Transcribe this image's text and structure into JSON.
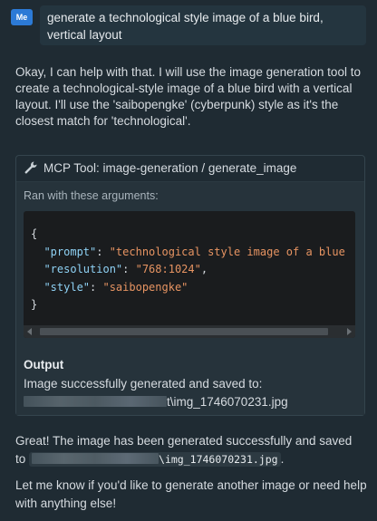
{
  "user_message": {
    "avatar": "Me",
    "text": "generate a technological style image of a blue bird, vertical layout"
  },
  "assistant_reply": "Okay, I can help with that. I will use the image generation tool to create a technological-style image of a blue bird with a vertical layout. I'll use the 'saibopengke' (cyberpunk) style as it's the closest match for 'technological'.",
  "tool_call": {
    "header": "MCP Tool: image-generation / generate_image",
    "icon": "wrench-icon",
    "arguments_label": "Ran with these arguments:",
    "code": {
      "open_brace": "{",
      "close_brace": "}",
      "args": [
        {
          "key": "\"prompt\"",
          "value": "\"technological style image of a blue",
          "comma": ""
        },
        {
          "key": "\"resolution\"",
          "value": "\"768:1024\"",
          "comma": ","
        },
        {
          "key": "\"style\"",
          "value": "\"saibopengke\"",
          "comma": ""
        }
      ]
    },
    "output_title": "Output",
    "output_line1": "Image successfully generated and saved to:",
    "output_path_visible": "t\\img_1746070231.jpg"
  },
  "final": {
    "line1": "Great! The image has been generated successfully and saved",
    "line2_prefix": "to",
    "path_visible": "\\img_1746070231.jpg",
    "line2_suffix": ".",
    "line3": "Let me know if you'd like to generate another image or need help with anything else!"
  }
}
